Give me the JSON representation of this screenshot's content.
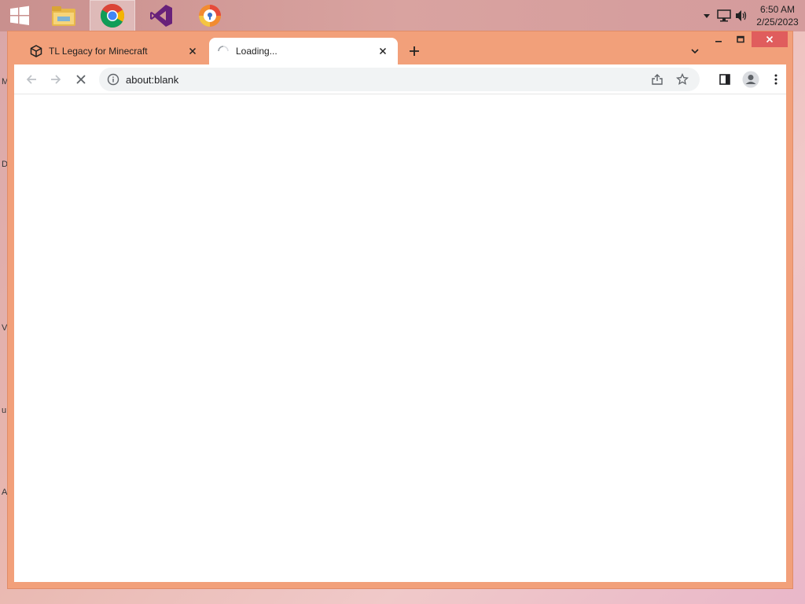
{
  "taskbar": {
    "apps": [
      {
        "name": "windows-start",
        "icon": "windows-logo-icon"
      },
      {
        "name": "file-explorer",
        "icon": "folder-icon"
      },
      {
        "name": "google-chrome",
        "icon": "chrome-icon",
        "active": true
      },
      {
        "name": "visual-studio",
        "icon": "visual-studio-icon"
      },
      {
        "name": "browser-app",
        "icon": "shield-browser-icon"
      }
    ],
    "clock": {
      "time": "6:50 AM",
      "date": "2/25/2023"
    }
  },
  "browser": {
    "tabs": [
      {
        "label": "TL Legacy for Minecraft",
        "icon": "cube-icon",
        "active": false
      },
      {
        "label": "Loading...",
        "icon": "loading-spinner-icon",
        "active": true
      }
    ],
    "address": {
      "url": "about:blank"
    },
    "colors": {
      "frame": "#f2a07a",
      "close": "#e05d5d",
      "content": "#ffffff"
    }
  },
  "desktop": {
    "edge_letters": [
      "M",
      "D",
      "V",
      "u",
      "A"
    ]
  }
}
